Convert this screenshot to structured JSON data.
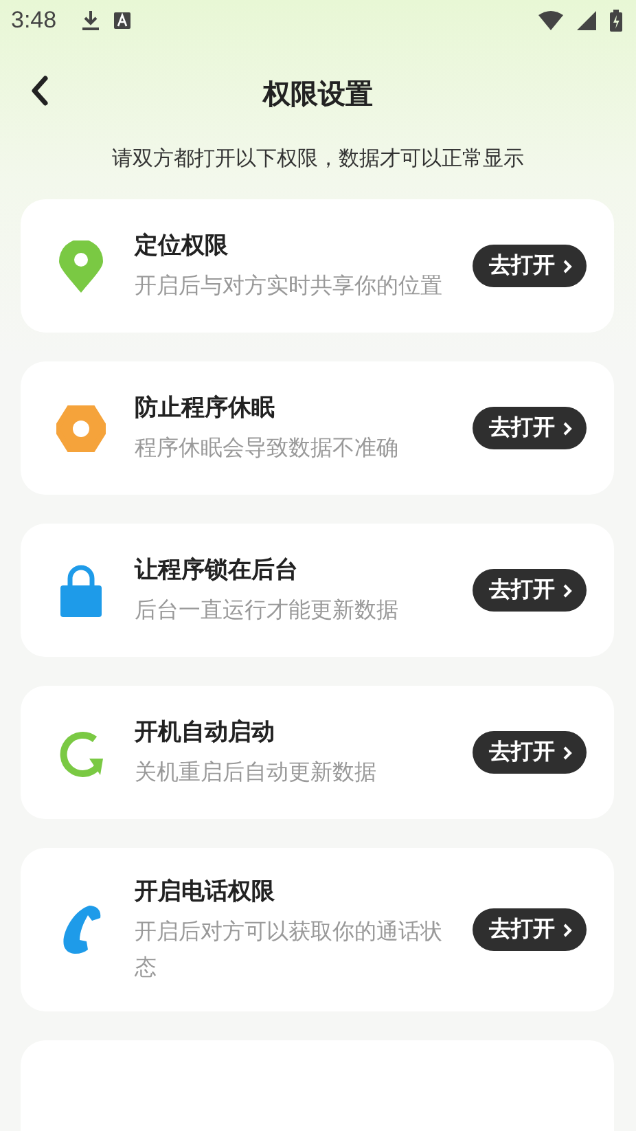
{
  "status_bar": {
    "time": "3:48"
  },
  "header": {
    "title": "权限设置"
  },
  "notice": "请双方都打开以下权限，数据才可以正常显示",
  "permissions": [
    {
      "kind": "pin",
      "title": "定位权限",
      "description": "开启后与对方实时共享你的位置",
      "button": "去打开"
    },
    {
      "kind": "gear",
      "title": "防止程序休眠",
      "description": "程序休眠会导致数据不准确",
      "button": "去打开"
    },
    {
      "kind": "lock",
      "title": "让程序锁在后台",
      "description": "后台一直运行才能更新数据",
      "button": "去打开"
    },
    {
      "kind": "refresh",
      "title": "开机自动启动",
      "description": "关机重启后自动更新数据",
      "button": "去打开"
    },
    {
      "kind": "phone",
      "title": "开启电话权限",
      "description": "开启后对方可以获取你的通话状态",
      "button": "去打开"
    }
  ]
}
